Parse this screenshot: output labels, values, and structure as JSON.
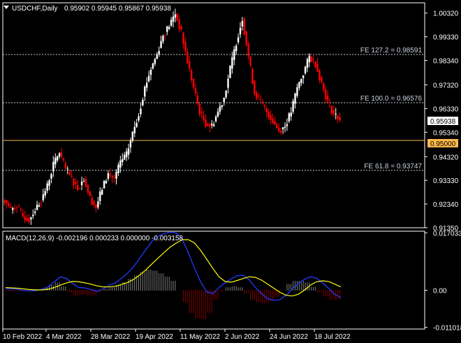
{
  "header": {
    "symbol": "USDCHF,Daily",
    "ohlc": "0.95902 0.95945 0.95867 0.95938",
    "dropdown_icon": "triangle-down-icon"
  },
  "price_axis": {
    "ticks": [
      "1.00320",
      "0.99330",
      "0.98340",
      "0.97320",
      "0.96330",
      "0.95340",
      "0.94320",
      "0.93330",
      "0.92340",
      "0.91350"
    ],
    "current_price_label": "0.95938",
    "level_label": "0.95000"
  },
  "fib_levels": [
    {
      "label": "FE 127.2 = 0.98591",
      "price": 0.98591
    },
    {
      "label": "FE 100.0 = 0.96576",
      "price": 0.96576
    },
    {
      "label": "FE 61.8 = 0.93747",
      "price": 0.93747
    }
  ],
  "horizontal_level": {
    "price": 0.95,
    "color": "#ffb84d"
  },
  "macd": {
    "title": "MACD(12,26,9) -0.002196 0.000233 0.000000 -0.003158",
    "ticks": [
      "0.017033",
      "0.00",
      "-0.011018"
    ]
  },
  "date_axis": [
    "10 Feb 2022",
    "4 Mar 2022",
    "28 Mar 2022",
    "19 Apr 2022",
    "11 May 2022",
    "2 Jun 2022",
    "24 Jun 2022",
    "18 Jul 2022"
  ],
  "colors": {
    "bull": "#ffffff",
    "bear": "#ff0000",
    "background": "#000000",
    "macd_line": "#1f3cff",
    "signal_line": "#ffff00"
  },
  "chart_data": {
    "type": "line",
    "series": [
      {
        "values": [
          0.925,
          0.921,
          0.923,
          0.918,
          0.917,
          0.921,
          0.925,
          0.931,
          0.94,
          0.945,
          0.938,
          0.934,
          0.93,
          0.934,
          0.926,
          0.922,
          0.93,
          0.936,
          0.934,
          0.941,
          0.944,
          0.953,
          0.961,
          0.972,
          0.98,
          0.986,
          0.994,
          0.998,
          1.003,
          0.995,
          0.983,
          0.972,
          0.962,
          0.957,
          0.956,
          0.962,
          0.968,
          0.98,
          0.991,
          1.001,
          0.985,
          0.97,
          0.966,
          0.962,
          0.958,
          0.954,
          0.956,
          0.962,
          0.972,
          0.978,
          0.985,
          0.982,
          0.974,
          0.966,
          0.961,
          0.959
        ]
      }
    ],
    "macd_values": [
      0.0005,
      0.0004,
      0.0003,
      -0.0001,
      -0.0002,
      -0.0001,
      0.0003,
      0.001,
      0.0025,
      0.004,
      0.0035,
      0.002,
      0.0008,
      0.0007,
      0.0002,
      -0.0003,
      0.0004,
      0.0015,
      0.0022,
      0.0035,
      0.005,
      0.007,
      0.0095,
      0.012,
      0.0145,
      0.016,
      0.0168,
      0.0172,
      0.017,
      0.015,
      0.011,
      0.0065,
      0.0025,
      -0.0005,
      -0.001,
      0.0008,
      0.0022,
      0.0034,
      0.0043,
      0.0045,
      0.003,
      0.0008,
      -0.001,
      -0.0025,
      -0.003,
      -0.0028,
      -0.0015,
      0.0003,
      0.002,
      0.0032,
      0.004,
      0.0036,
      0.0022,
      0.0006,
      -0.0012,
      -0.0022
    ],
    "signal_values": [
      0.0008,
      0.0007,
      0.0006,
      0.0004,
      0.0002,
      0.0001,
      0.0001,
      0.0003,
      0.0008,
      0.0015,
      0.0022,
      0.0026,
      0.0025,
      0.0022,
      0.0018,
      0.0013,
      0.001,
      0.001,
      0.0012,
      0.0017,
      0.0023,
      0.0032,
      0.0045,
      0.006,
      0.0078,
      0.0095,
      0.0112,
      0.0128,
      0.014,
      0.015,
      0.015,
      0.014,
      0.0118,
      0.0092,
      0.0065,
      0.004,
      0.0026,
      0.0024,
      0.0029,
      0.0035,
      0.004,
      0.0038,
      0.003,
      0.0018,
      0.0006,
      -0.0006,
      -0.0015,
      -0.0017,
      -0.0012,
      0.0,
      0.0015,
      0.0025,
      0.0028,
      0.0026,
      0.0018,
      0.001
    ],
    "ylim": [
      0.9135,
      1.0075
    ],
    "macd_ylim": [
      -0.0115,
      0.0175
    ]
  }
}
